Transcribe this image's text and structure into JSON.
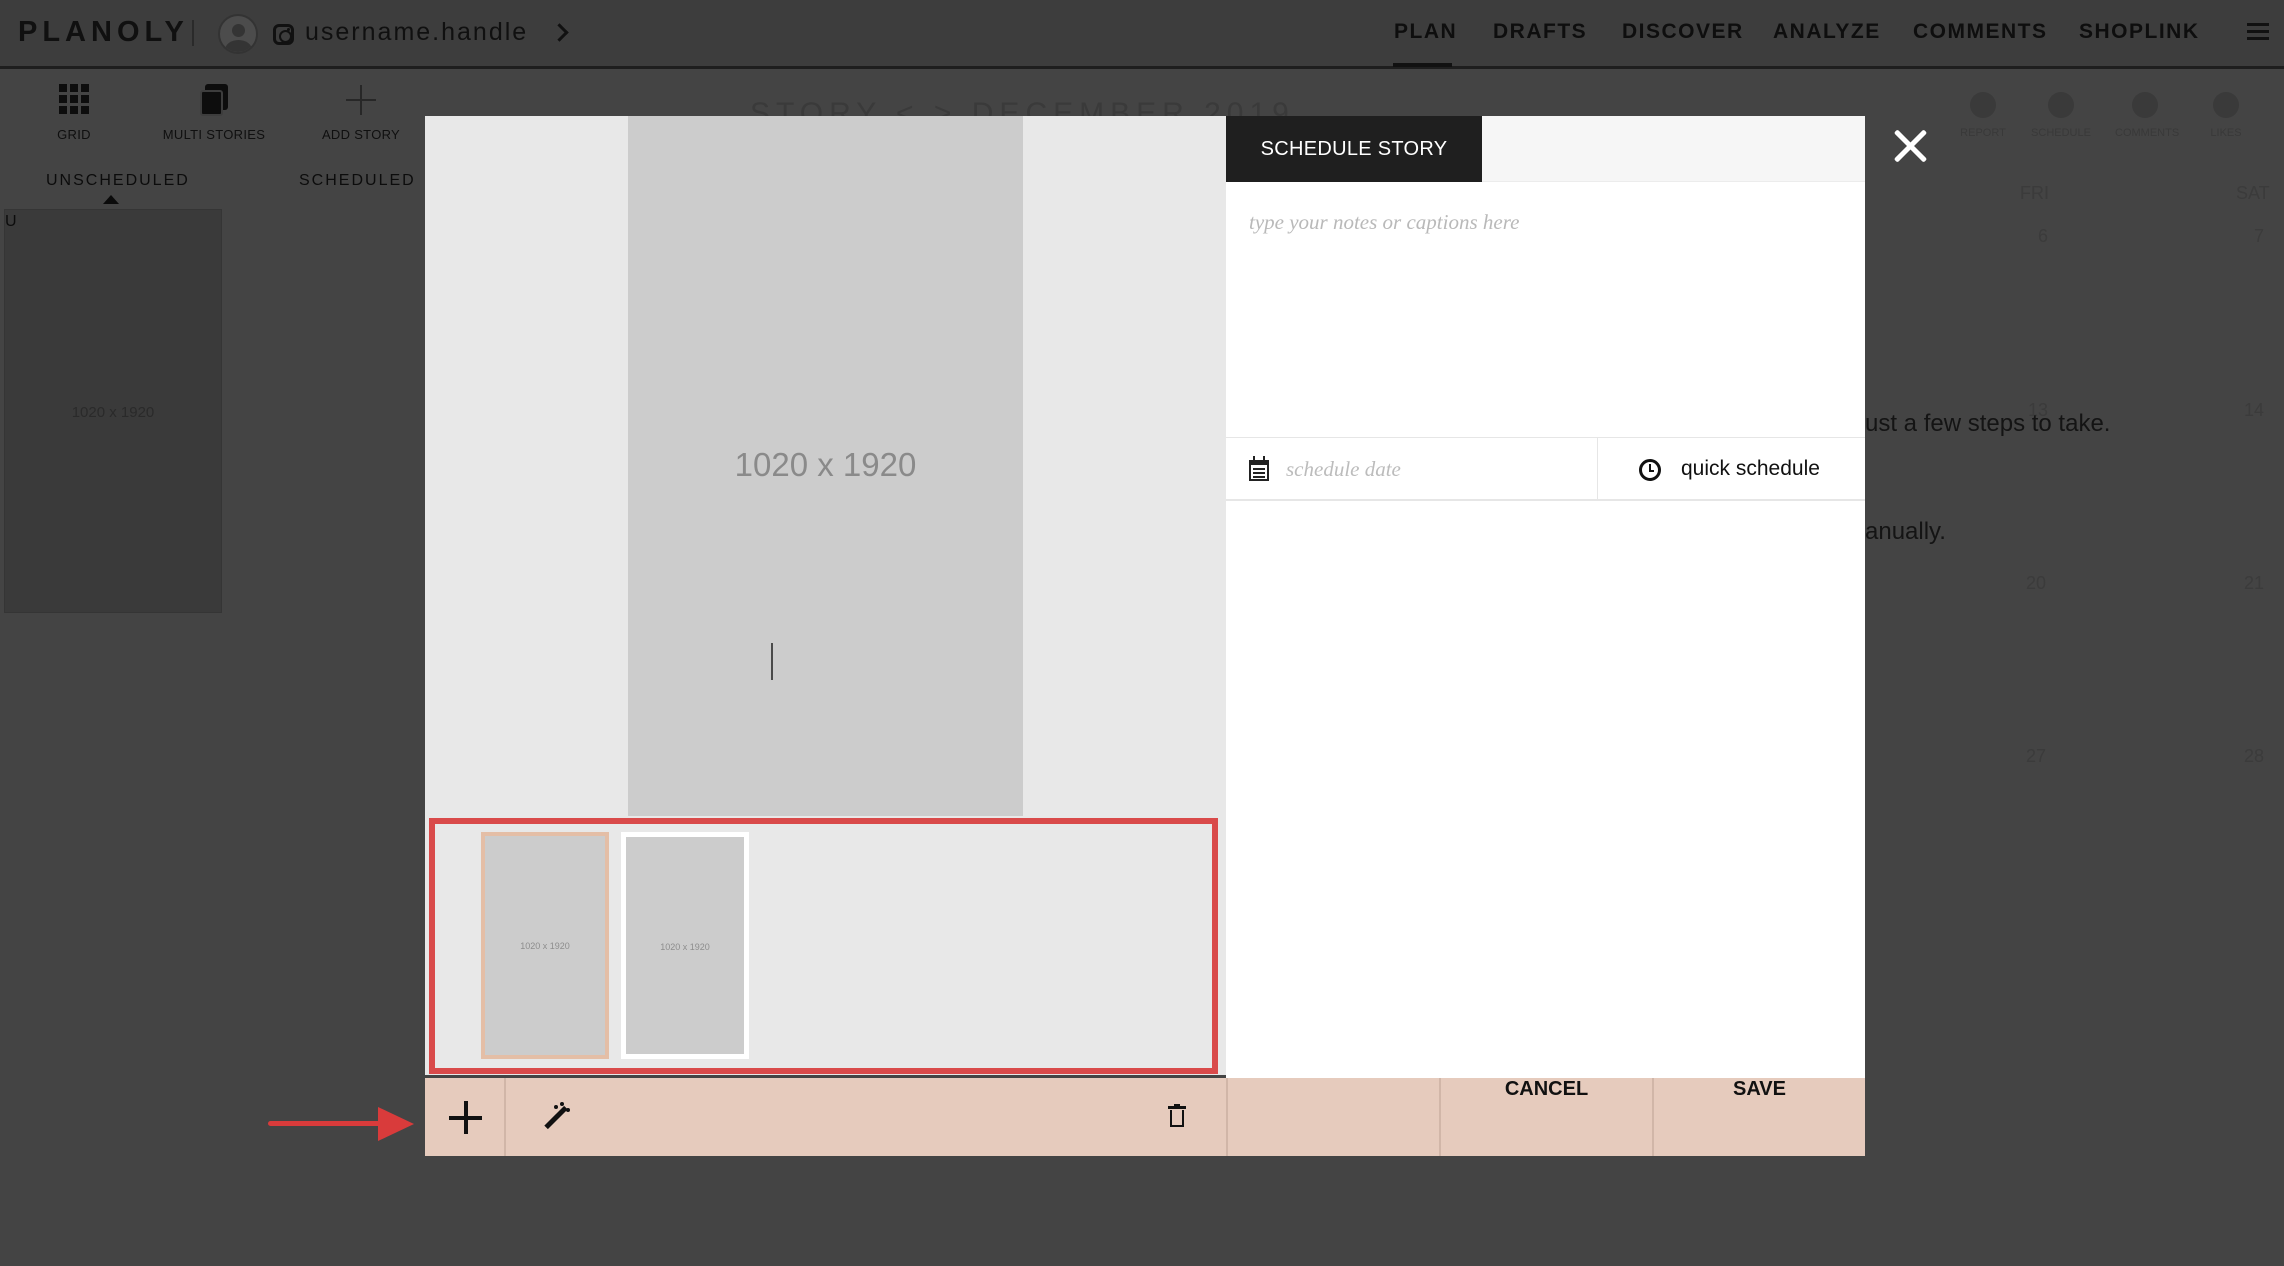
{
  "app": {
    "logo": "PLANOLY",
    "username": "username.handle"
  },
  "nav": {
    "links": [
      "PLAN",
      "DRAFTS",
      "DISCOVER",
      "ANALYZE",
      "COMMENTS",
      "SHOPLINK"
    ],
    "active": "PLAN"
  },
  "toolbar": {
    "grid": "GRID",
    "multi_stories": "MULTI STORIES",
    "add_story": "ADD STORY"
  },
  "story_tabs": {
    "unscheduled": "UNSCHEDULED",
    "scheduled": "SCHEDULED",
    "active": "UNSCHEDULED"
  },
  "sidebar": {
    "section_letter": "U",
    "thumb_label": "1020 x 1920"
  },
  "background": {
    "calendar_title": "STORY < > DECEMBER 2019",
    "tools": [
      "REPORT",
      "SCHEDULE",
      "COMMENTS",
      "LIKES"
    ],
    "day_headers": [
      "FRI",
      "SAT"
    ],
    "dates": [
      "6",
      "7",
      "13",
      "14",
      "20",
      "21",
      "27",
      "28"
    ],
    "text_line_1": "ust a few steps to take.",
    "text_line_2": "anually."
  },
  "modal": {
    "preview_label": "1020 x 1920",
    "thumbnails": [
      {
        "label": "1020 x 1920",
        "selected": true
      },
      {
        "label": "1020 x 1920",
        "selected": false
      }
    ],
    "tab_label": "SCHEDULE STORY",
    "notes_placeholder": "type your notes or captions here",
    "date_placeholder": "schedule date",
    "quick_schedule_label": "quick schedule",
    "cancel_label": "CANCEL",
    "save_label": "SAVE"
  },
  "colors": {
    "overlay_bg": "#444444",
    "bottom_bar": "#e6cbbd",
    "highlight": "#d94a4a",
    "selected_thumb_border": "#e4bea6",
    "tab_active_bg": "#1f1f1f"
  },
  "icons": [
    "avatar-icon",
    "instagram-icon",
    "chevron-right-icon",
    "hamburger-menu-icon",
    "grid-icon",
    "multi-stories-icon",
    "add-story-icon",
    "close-icon",
    "calendar-icon",
    "clock-icon",
    "plus-icon",
    "magic-wand-icon",
    "trash-icon",
    "red-arrow-annotation"
  ]
}
